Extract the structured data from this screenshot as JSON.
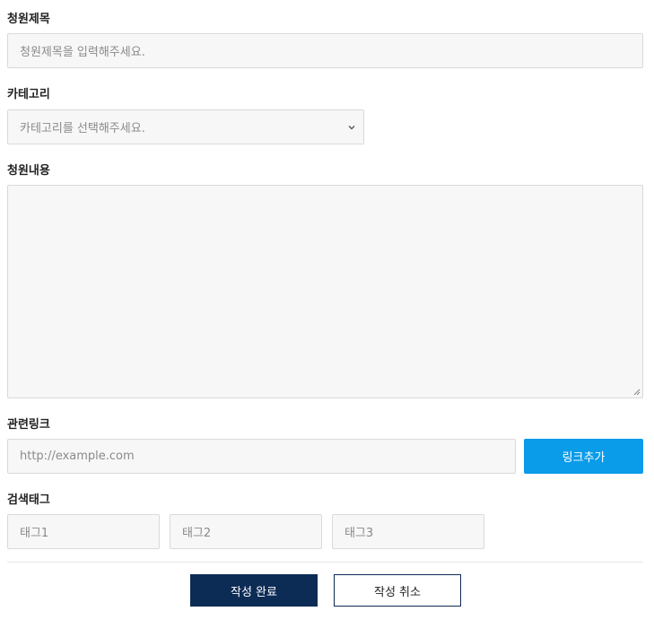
{
  "title_field": {
    "label": "청원제목",
    "placeholder": "청원제목을 입력해주세요."
  },
  "category_field": {
    "label": "카테고리",
    "selected": "카테고리를 선택해주세요."
  },
  "content_field": {
    "label": "청원내용",
    "value": ""
  },
  "link_field": {
    "label": "관련링크",
    "placeholder": "http://example.com",
    "add_button": "링크추가"
  },
  "tags_field": {
    "label": "검색태그",
    "tags": [
      "태그1",
      "태그2",
      "태그3"
    ]
  },
  "actions": {
    "submit_label": "작성 완료",
    "cancel_label": "작성 취소"
  },
  "colors": {
    "link_button": "#0a9be9",
    "submit_button": "#0c2b55",
    "field_background": "#f7f7f7",
    "field_border": "#d9d9d9"
  }
}
